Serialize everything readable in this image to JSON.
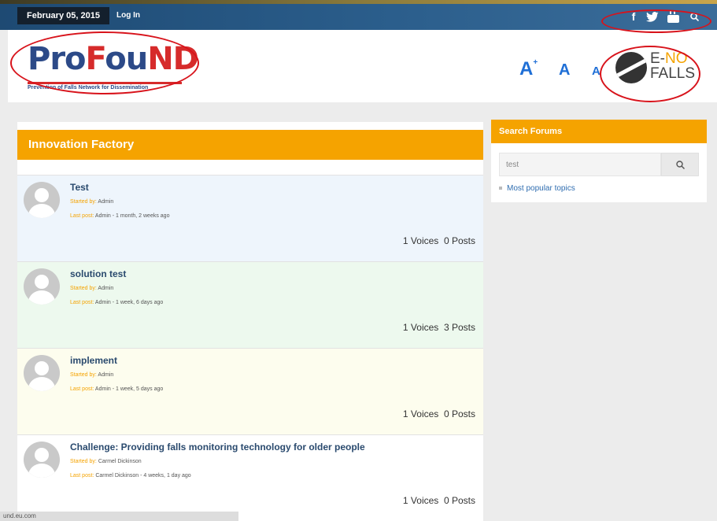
{
  "topbar": {
    "date": "February 05, 2015",
    "login": "Log In",
    "social_icons": [
      "facebook-icon",
      "twitter-icon",
      "youtube-icon",
      "search-icon"
    ]
  },
  "header": {
    "logo_text_1": "Pro",
    "logo_text_2": "F",
    "logo_text_3": "ou",
    "logo_text_4": "ND",
    "logo_subtitle": "Prevention of Falls Network for Dissemination",
    "font_size_controls": [
      "A",
      "A",
      "A"
    ],
    "font_size_plus": "+",
    "enofalls_line1_a": "E-",
    "enofalls_line1_b": "NO",
    "enofalls_line2": "FALLS"
  },
  "forum": {
    "title": "Innovation Factory",
    "topics": [
      {
        "title": "Test",
        "started_label": "Started by:",
        "started_by": "Admin",
        "last_label": "Last post:",
        "last_post": "Admin - 1 month, 2 weeks ago",
        "voices": "1 Voices",
        "posts": "0 Posts",
        "bg": "#eef5fc"
      },
      {
        "title": "solution test",
        "started_label": "Started by:",
        "started_by": "Admin",
        "last_label": "Last post:",
        "last_post": "Admin - 1 week, 6 days ago",
        "voices": "1 Voices",
        "posts": "3 Posts",
        "bg": "#edf9ee"
      },
      {
        "title": "implement",
        "started_label": "Started by:",
        "started_by": "Admin",
        "last_label": "Last post:",
        "last_post": "Admin - 1 week, 5 days ago",
        "voices": "1 Voices",
        "posts": "0 Posts",
        "bg": "#fdfdee"
      },
      {
        "title": "Challenge: Providing falls monitoring technology for older people",
        "started_label": "Started by:",
        "started_by": "Carmel Dickinson",
        "last_label": "Last post:",
        "last_post": "Carmel Dickinson - 4 weeks, 1 day ago",
        "voices": "1 Voices",
        "posts": "0 Posts",
        "bg": "#ffffff"
      }
    ]
  },
  "sidebar": {
    "title": "Search Forums",
    "search_value": "test",
    "link": "Most popular topics"
  },
  "statusbar": {
    "text": "und.eu.com"
  },
  "colors": {
    "accent_orange": "#f5a300",
    "topbar_blue": "#2b5e8c",
    "annotation_red": "#d8131b"
  }
}
